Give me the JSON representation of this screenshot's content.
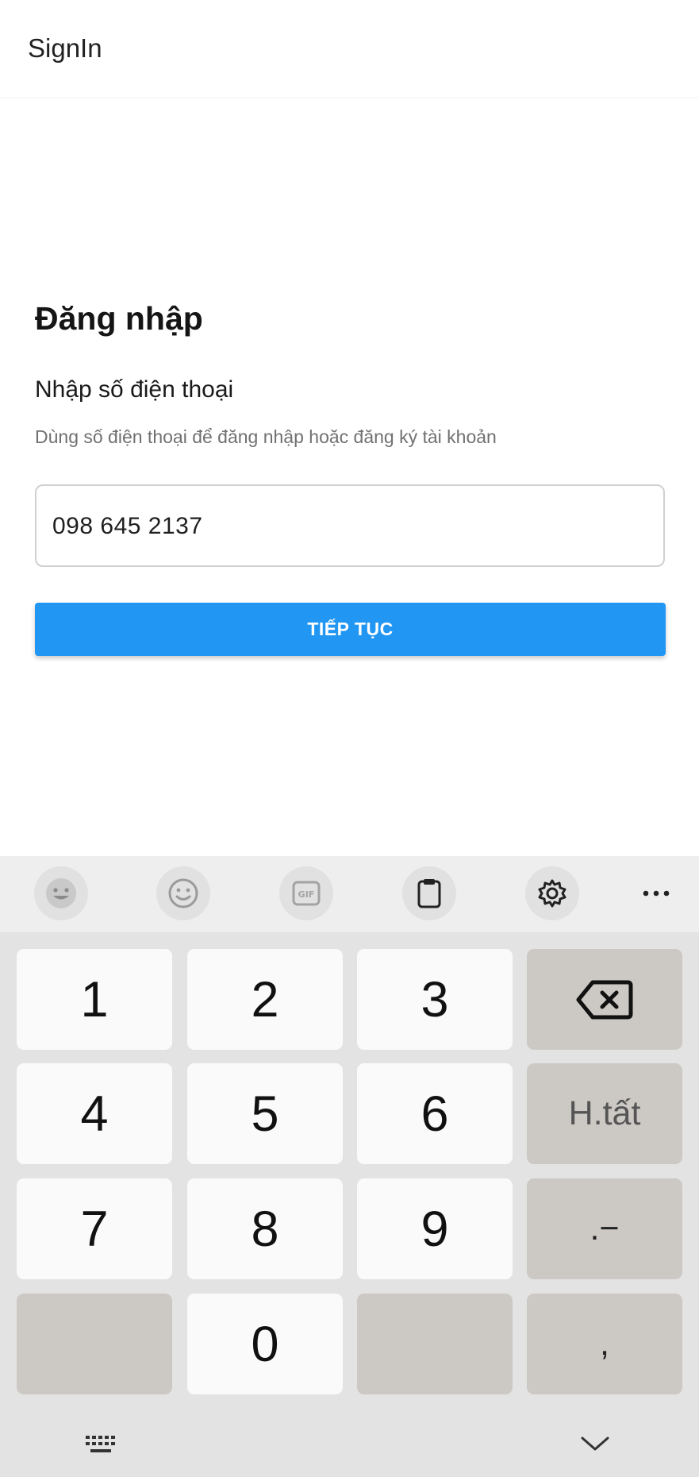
{
  "appbar": {
    "title": "SignIn"
  },
  "form": {
    "heading": "Đăng nhập",
    "label": "Nhập số điện thoại",
    "hint": "Dùng số điện thoại để đăng nhập hoặc đăng ký tài khoản",
    "phone_value": "098 645 2137",
    "continue_label": "TIẾP TỤC"
  },
  "keyboard": {
    "toolbar_icons": [
      "emoji-sticker-icon",
      "smiley-icon",
      "gif-icon",
      "clipboard-icon",
      "gear-icon",
      "more-icon"
    ],
    "toolbar_more": "...",
    "keys": {
      "k1": "1",
      "k2": "2",
      "k3": "3",
      "k4": "4",
      "k5": "5",
      "k6": "6",
      "k7": "7",
      "k8": "8",
      "k9": "9",
      "k0": "0",
      "done": "H.tất",
      "dot_dash": ".−",
      "comma": ","
    }
  },
  "colors": {
    "accent": "#2196f3",
    "keyboard_bg": "#e3e3e3",
    "key_bg": "#fafafa",
    "function_key_bg": "#ccc9c5"
  }
}
